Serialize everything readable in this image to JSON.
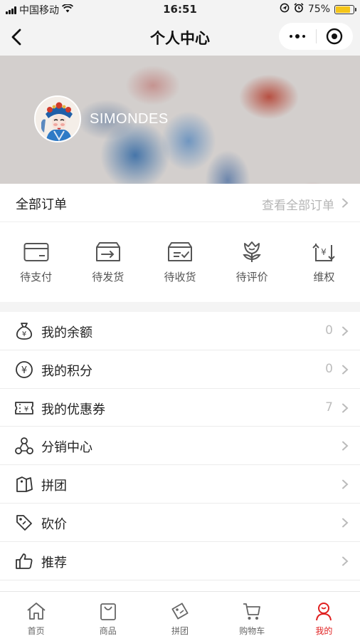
{
  "status_bar": {
    "carrier": "中国移动",
    "time": "16:51",
    "battery_percent": "75%",
    "battery_level": 0.75,
    "icons": [
      "signal-icon",
      "wifi-icon",
      "location-icon",
      "alarm-icon",
      "battery-icon"
    ]
  },
  "nav": {
    "title": "个人中心",
    "icons": [
      "back-icon",
      "more-icon",
      "target-icon"
    ]
  },
  "profile": {
    "username": "SIMONDES"
  },
  "orders": {
    "title": "全部订单",
    "view_all": "查看全部订单",
    "items": [
      {
        "label": "待支付",
        "icon": "card-icon"
      },
      {
        "label": "待发货",
        "icon": "ship-box-icon"
      },
      {
        "label": "待收货",
        "icon": "receive-box-icon"
      },
      {
        "label": "待评价",
        "icon": "review-flower-icon"
      },
      {
        "label": "维权",
        "icon": "refund-icon"
      }
    ]
  },
  "menu": [
    {
      "label": "我的余额",
      "value": "0",
      "icon": "money-bag-icon"
    },
    {
      "label": "我的积分",
      "value": "0",
      "icon": "points-coin-icon"
    },
    {
      "label": "我的优惠券",
      "value": "7",
      "icon": "coupon-icon"
    },
    {
      "label": "分销中心",
      "value": "",
      "icon": "distribution-icon"
    },
    {
      "label": "拼团",
      "value": "",
      "icon": "group-buy-icon"
    },
    {
      "label": "砍价",
      "value": "",
      "icon": "bargain-tag-icon"
    },
    {
      "label": "推荐",
      "value": "",
      "icon": "thumbs-up-icon"
    }
  ],
  "tab_bar": {
    "items": [
      {
        "label": "首页",
        "icon": "home-icon",
        "active": false
      },
      {
        "label": "商品",
        "icon": "bag-icon",
        "active": false
      },
      {
        "label": "拼团",
        "icon": "tag-icon",
        "active": false
      },
      {
        "label": "购物车",
        "icon": "cart-icon",
        "active": false
      },
      {
        "label": "我的",
        "icon": "profile-icon",
        "active": true
      }
    ]
  },
  "colors": {
    "accent": "#e02020",
    "nav_background": "#f3f3f3",
    "battery": "#f5c518"
  }
}
